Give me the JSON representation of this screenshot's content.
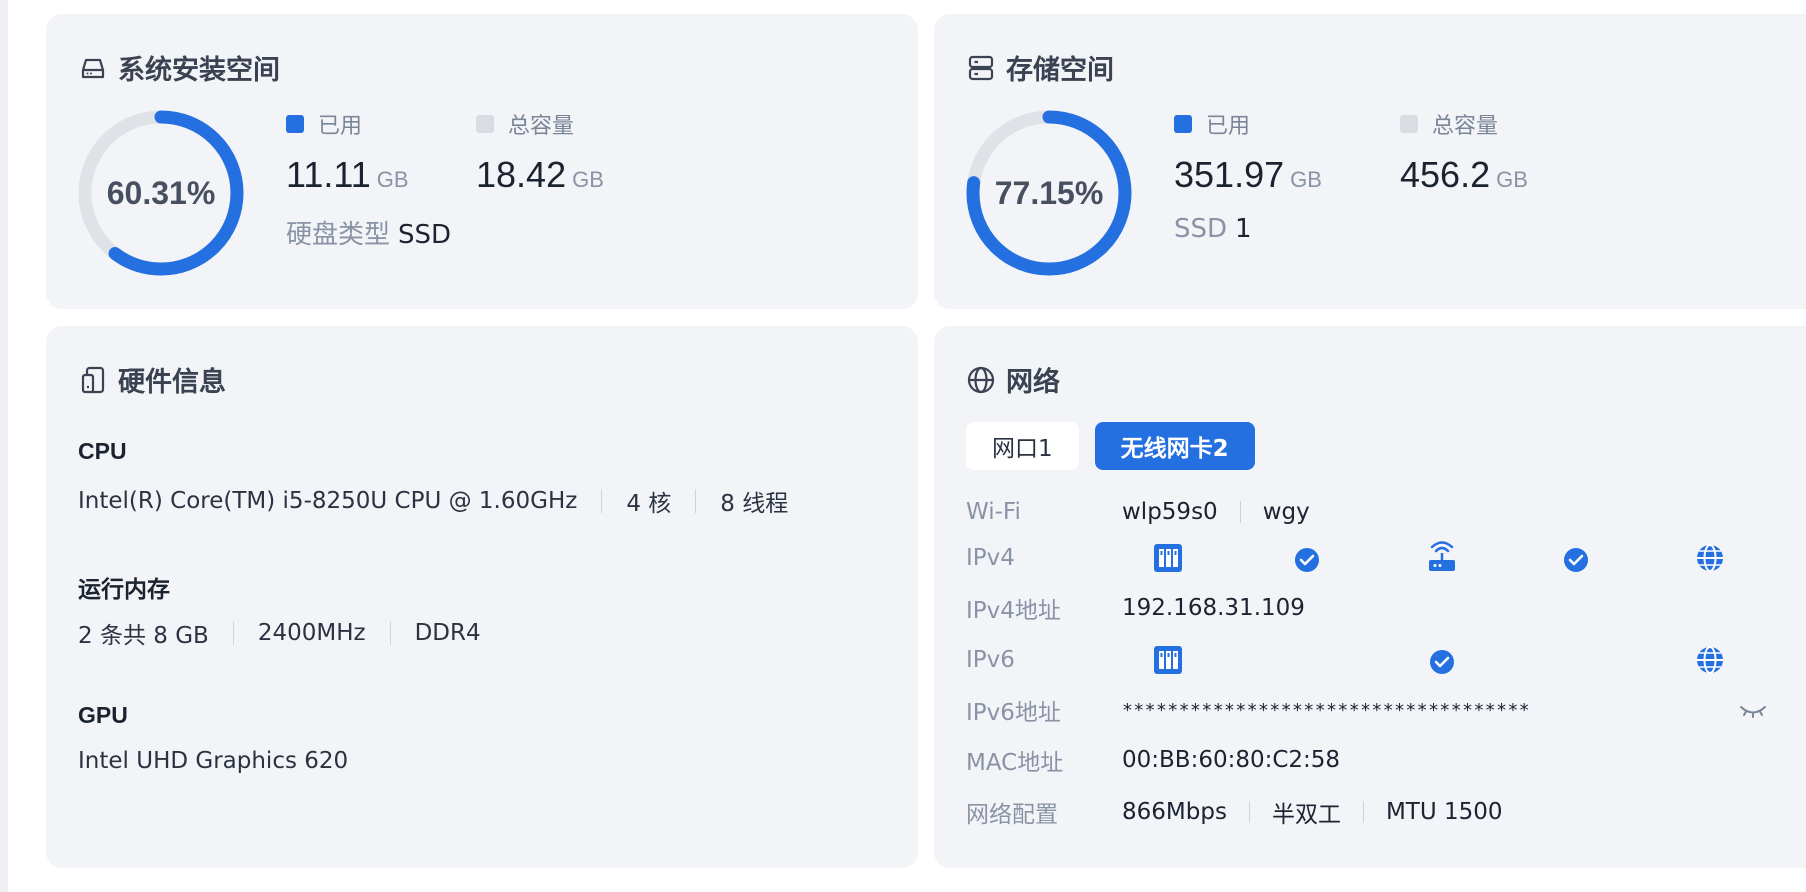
{
  "system_space": {
    "title": "系统安装空间",
    "percent_label": "60.31%",
    "percent": 60.31,
    "used_label": "已用",
    "used_value": "11.11",
    "used_unit": "GB",
    "total_label": "总容量",
    "total_value": "18.42",
    "total_unit": "GB",
    "disk_type_key": "硬盘类型",
    "disk_type_value": "SSD"
  },
  "storage": {
    "title": "存储空间",
    "percent_label": "77.15%",
    "percent": 77.15,
    "used_label": "已用",
    "used_value": "351.97",
    "used_unit": "GB",
    "total_label": "总容量",
    "total_value": "456.2",
    "total_unit": "GB",
    "ssd_key": "SSD",
    "ssd_value": "1"
  },
  "hardware": {
    "title": "硬件信息",
    "cpu_head": "CPU",
    "cpu_model": "Intel(R) Core(TM) i5-8250U CPU @ 1.60GHz",
    "cpu_cores": "4 核",
    "cpu_threads": "8 线程",
    "mem_head": "运行内存",
    "mem_slots": "2 条共 8 GB",
    "mem_freq": "2400MHz",
    "mem_type": "DDR4",
    "gpu_head": "GPU",
    "gpu_model": "Intel UHD Graphics 620"
  },
  "network": {
    "title": "网络",
    "tabs": [
      "网口1",
      "无线网卡2"
    ],
    "active_tab": "无线网卡2",
    "wifi_key": "Wi-Fi",
    "wifi_iface": "wlp59s0",
    "wifi_ssid": "wgy",
    "ipv4_key": "IPv4",
    "ipv4_addr_key": "IPv4地址",
    "ipv4_addr": "192.168.31.109",
    "ipv6_key": "IPv6",
    "ipv6_addr_key": "IPv6地址",
    "ipv6_addr": "************************************",
    "mac_key": "MAC地址",
    "mac": "00:BB:60:80:C2:58",
    "config_key": "网络配置",
    "speed": "866Mbps",
    "duplex": "半双工",
    "mtu": "MTU 1500"
  },
  "colors": {
    "accent": "#2470e0",
    "ring_track": "#dfe2e7",
    "card_bg": "#f3f4f7",
    "muted_text": "#8a93a5"
  },
  "icons": {
    "system_space": "hard-drive-icon",
    "storage": "server-icon",
    "hardware": "device-icon",
    "network": "globe-icon",
    "device_node": "device-panel-icon",
    "router_node": "router-icon",
    "internet_node": "globe-icon",
    "check": "check-circle-icon",
    "hide": "eye-closed-icon"
  }
}
